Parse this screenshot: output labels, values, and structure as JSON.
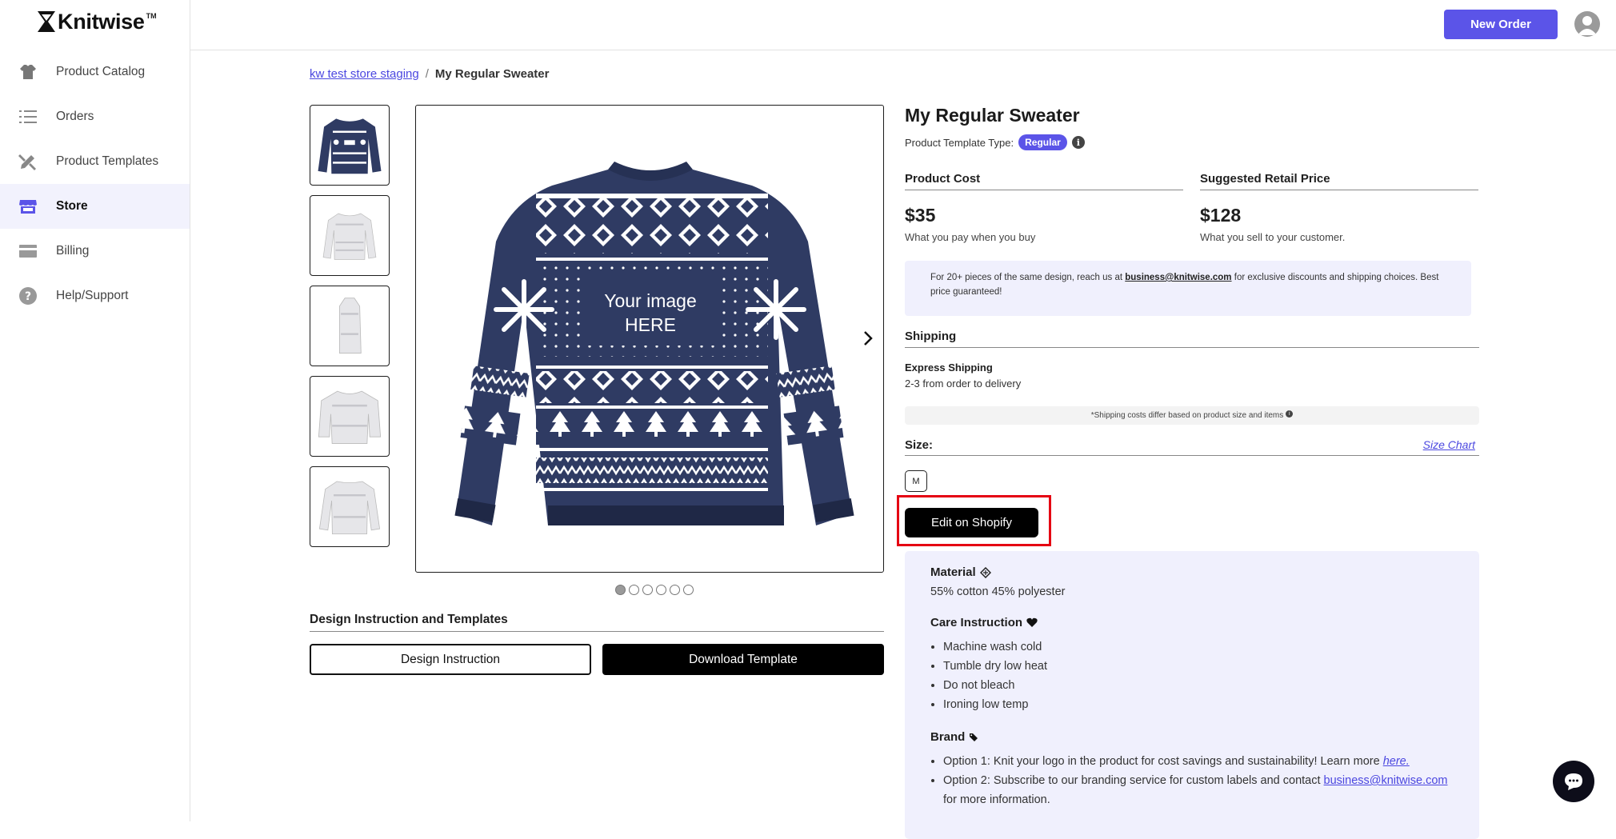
{
  "brand": {
    "name": "Knitwise",
    "tm": "TM"
  },
  "sidebar": {
    "items": [
      {
        "label": "Product Catalog",
        "icon": "sweater-icon",
        "active": false
      },
      {
        "label": "Orders",
        "icon": "list-icon",
        "active": false
      },
      {
        "label": "Product Templates",
        "icon": "design-tools-icon",
        "active": false
      },
      {
        "label": "Store",
        "icon": "store-icon",
        "active": true
      },
      {
        "label": "Billing",
        "icon": "credit-card-icon",
        "active": false
      },
      {
        "label": "Help/Support",
        "icon": "help-icon",
        "active": false
      }
    ]
  },
  "topbar": {
    "new_order_label": "New Order"
  },
  "breadcrumb": {
    "store": "kw test store staging",
    "separator": "/",
    "current": "My Regular Sweater"
  },
  "gallery": {
    "image_text_line1": "Your image",
    "image_text_line2": "HERE",
    "dot_count": 6,
    "active_dot": 0
  },
  "design": {
    "title": "Design Instruction and Templates",
    "instruction_label": "Design Instruction",
    "download_label": "Download Template"
  },
  "product": {
    "title": "My Regular Sweater",
    "type_label": "Product Template Type:",
    "type_badge": "Regular",
    "cost_header": "Product Cost",
    "cost_value": "$35",
    "cost_desc": "What you pay when you buy",
    "retail_header": "Suggested Retail Price",
    "retail_value": "$128",
    "retail_desc": "What you sell to your customer.",
    "bulk_prefix": "For 20+ pieces of the same design, reach us at",
    "bulk_email": "business@knitwise.com",
    "bulk_suffix": "for exclusive discounts and shipping choices. Best price guaranteed!"
  },
  "shipping": {
    "title": "Shipping",
    "method": "Express Shipping",
    "desc": "2-3 from order to delivery",
    "note": "*Shipping costs differ based on product size and items"
  },
  "size": {
    "label": "Size:",
    "chart_link": "Size Chart",
    "selected": "M"
  },
  "actions": {
    "edit_shopify": "Edit on Shopify"
  },
  "details": {
    "material_title": "Material",
    "material_text": "55% cotton 45% polyester",
    "care_title": "Care Instruction",
    "care_items": [
      "Machine wash cold",
      "Tumble dry low heat",
      "Do not bleach",
      "Ironing low temp"
    ],
    "brand_title": "Brand",
    "brand_option1": "Option 1: Knit your logo in the product for cost savings and sustainability! Learn more",
    "brand_option1_link": "here.",
    "brand_option2": "Option 2: Subscribe to our branding service for custom labels and contact",
    "brand_option2_email": "business@knitwise.com",
    "brand_option2_suffix": "for more information."
  },
  "colors": {
    "accent": "#5b54e8",
    "highlight": "#e50012",
    "sweater": "#2f3b63"
  }
}
